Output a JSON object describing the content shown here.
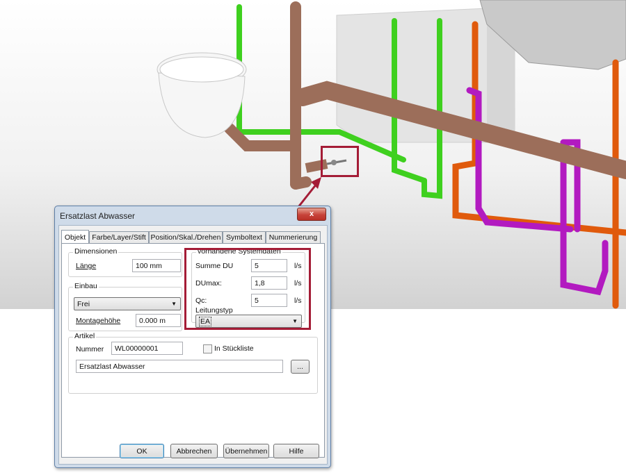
{
  "dialog": {
    "title": "Ersatzlast Abwasser",
    "close_label": "x",
    "tabs": [
      {
        "label": "Objekt",
        "active": true
      },
      {
        "label": "Farbe/Layer/Stift"
      },
      {
        "label": "Position/Skal./Drehen"
      },
      {
        "label": "Symboltext"
      },
      {
        "label": "Nummerierung"
      }
    ],
    "dimensionen": {
      "group_label": "Dimensionen",
      "laenge_label": "Länge",
      "laenge_value": "100 mm"
    },
    "einbau": {
      "group_label": "Einbau",
      "mode_value": "Frei",
      "montagehoehe_label": "Montagehöhe",
      "montagehoehe_value": "0.000 m"
    },
    "systemdaten": {
      "group_label": "vorhandene Systemdaten",
      "rows": [
        {
          "label": "Summe DU",
          "value": "5",
          "unit": "l/s"
        },
        {
          "label": "DUmax:",
          "value": "1,8",
          "unit": "l/s"
        },
        {
          "label": "Qc:",
          "value": "5",
          "unit": "l/s"
        }
      ],
      "leitungstyp_label": "Leitungstyp",
      "leitungstyp_value": "EA"
    },
    "artikel": {
      "group_label": "Artikel",
      "nummer_label": "Nummer",
      "nummer_value": "WL00000001",
      "stueckliste_label": "In Stückliste",
      "stueckliste_checked": false,
      "name_value": "Ersatzlast Abwasser",
      "browse_label": "..."
    },
    "buttons": {
      "ok": "OK",
      "cancel": "Abbrechen",
      "apply": "Übernehmen",
      "help": "Hilfe"
    }
  },
  "colors": {
    "highlight": "#a41c36",
    "pipe_brown": "#9c6e5a",
    "pipe_green": "#3fd01f",
    "pipe_orange": "#e05a0c",
    "pipe_magenta": "#b21ac0"
  }
}
